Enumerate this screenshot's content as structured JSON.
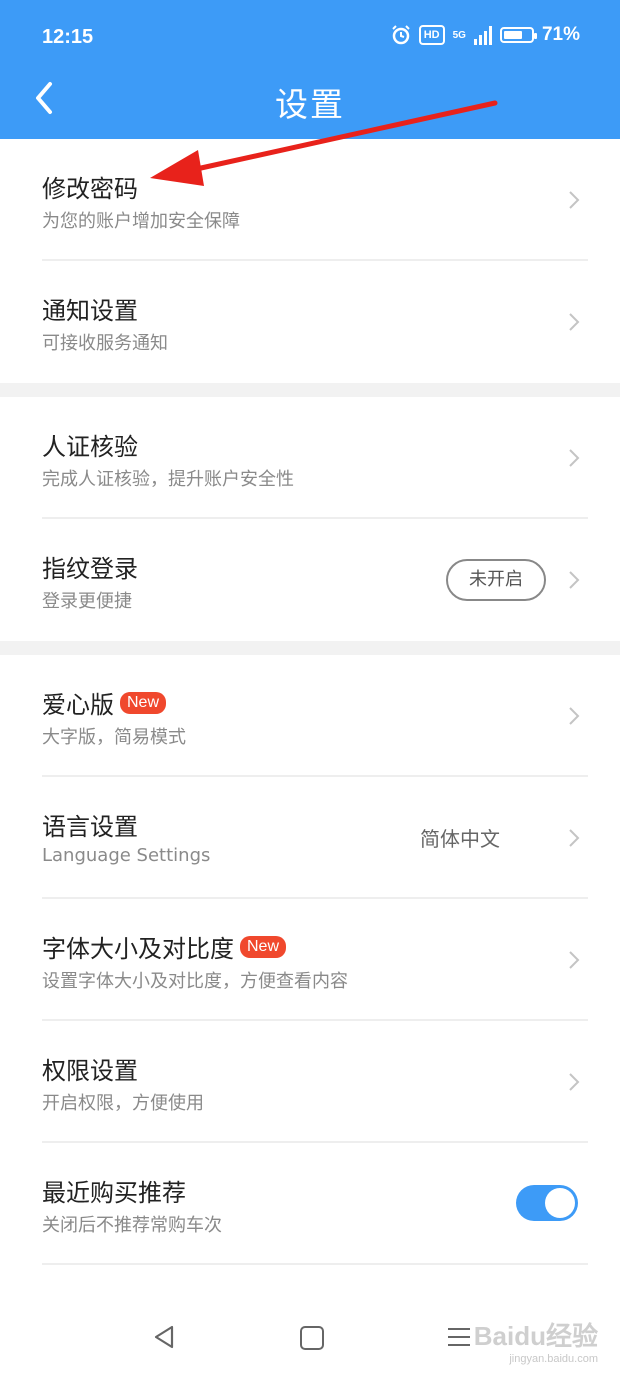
{
  "status_bar": {
    "time": "12:15",
    "hd": "HD",
    "network": "5G",
    "battery": "71%",
    "battery_level": 0.71
  },
  "header": {
    "title": "设置"
  },
  "settings": [
    {
      "title": "修改密码",
      "subtitle": "为您的账户增加安全保障"
    },
    {
      "title": "通知设置",
      "subtitle": "可接收服务通知"
    },
    {
      "title": "人证核验",
      "subtitle": "完成人证核验，提升账户安全性"
    },
    {
      "title": "指纹登录",
      "subtitle": "登录更便捷",
      "status": "未开启"
    },
    {
      "title": "爱心版",
      "badge": "New",
      "subtitle": "大字版，简易模式"
    },
    {
      "title": "语言设置",
      "subtitle": "Language Settings",
      "value": "简体中文"
    },
    {
      "title": "字体大小及对比度",
      "badge": "New",
      "subtitle": "设置字体大小及对比度，方便查看内容"
    },
    {
      "title": "权限设置",
      "subtitle": "开启权限，方便使用"
    },
    {
      "title": "最近购买推荐",
      "subtitle": "关闭后不推荐常购车次",
      "toggle_on": true
    }
  ],
  "watermark": {
    "text": "Baidu经验",
    "url": "jingyan.baidu.com"
  },
  "colors": {
    "primary": "#3d9bf7",
    "badge": "#f0482d",
    "annotation_arrow": "#e8221b"
  },
  "icons": {
    "back": "chevron-left-icon",
    "row": "chevron-right-icon"
  }
}
